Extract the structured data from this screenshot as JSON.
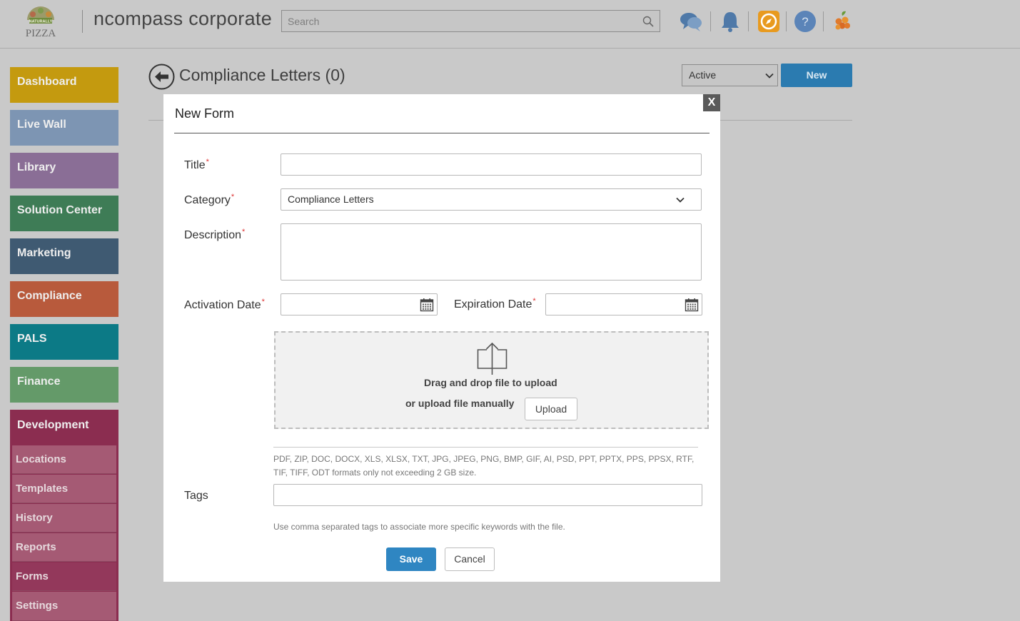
{
  "header": {
    "logo_text_top": "NATURALLY",
    "logo_text_bottom": "PIZZA",
    "company": "ncompass corporate",
    "search_placeholder": "Search",
    "icons": [
      "chat-icon",
      "bell-icon",
      "compass-icon",
      "help-icon",
      "fruit-avatar-icon"
    ]
  },
  "sidebar": {
    "items": [
      {
        "label": "Dashboard",
        "color": "#c49a0f"
      },
      {
        "label": "Live Wall",
        "color": "#7d95b3"
      },
      {
        "label": "Library",
        "color": "#8a6e96"
      },
      {
        "label": "Solution Center",
        "color": "#3e7c56"
      },
      {
        "label": "Marketing",
        "color": "#3f5a72"
      },
      {
        "label": "Compliance",
        "color": "#b85a3c"
      },
      {
        "label": "PALS",
        "color": "#0c7a86"
      },
      {
        "label": "Finance",
        "color": "#649a69"
      },
      {
        "label": "Development",
        "color": "#8b2d50"
      }
    ],
    "sub_items": [
      {
        "label": "Locations"
      },
      {
        "label": "Templates"
      },
      {
        "label": "History"
      },
      {
        "label": "Reports"
      },
      {
        "label": "Forms"
      },
      {
        "label": "Settings"
      }
    ]
  },
  "page": {
    "title": "Compliance Letters (0)",
    "status_value": "Active",
    "new_label": "New"
  },
  "modal": {
    "title": "New Form",
    "close_label": "X",
    "title_label": "Title",
    "category_label": "Category",
    "category_value": "Compliance Letters",
    "description_label": "Description",
    "activation_label": "Activation Date",
    "expiration_label": "Expiration Date",
    "required_mark": "*",
    "drop_text": "Drag and drop file to upload",
    "manual_text": "or upload file manually",
    "upload_label": "Upload",
    "formats_text": "PDF, ZIP, DOC, DOCX, XLS, XLSX, TXT, JPG, JPEG, PNG, BMP, GIF, AI, PSD, PPT, PPTX, PPS, PPSX, RTF, TIF, TIFF, ODT formats only not exceeding 2 GB size.",
    "tags_label": "Tags",
    "tags_hint": "Use comma separated tags to associate more specific keywords with the file.",
    "save_label": "Save",
    "cancel_label": "Cancel"
  }
}
